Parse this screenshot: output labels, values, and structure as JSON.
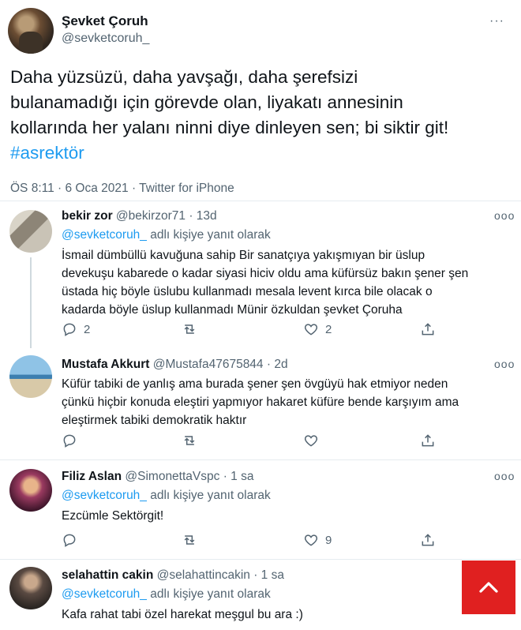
{
  "main_tweet": {
    "name": "Şevket Çoruh",
    "handle": "@sevketcoruh_",
    "more_icon": "···",
    "text_lines": [
      "Daha yüzsüzü, daha yavşağı,  daha şerefsizi",
      "bulanamadığı için görevde olan, liyakatı annesinin",
      "kollarında her yalanı ninni diye dinleyen sen; bi siktir git!"
    ],
    "hashtag": "#asrektör",
    "meta": "ÖS 8:11 · 6 Oca 2021 · Twitter for iPhone"
  },
  "replies": [
    {
      "name": "bekir zor",
      "handle": "@bekirzor71",
      "time": "· 13d",
      "replying_link": "@sevketcoruh_",
      "replying_suffix": " adlı kişiye yanıt olarak",
      "text_lines": [
        "İsmail dümbüllü kavuğuna sahip Bir sanatçıya yakışmıyan bir üslup",
        "devekuşu kabarede o kadar siyasi hiciv oldu ama küfürsüz bakın şener şen",
        "üstada hiç böyle üslubu kullanmadı mesala levent kırca bile olacak o",
        "kadarda böyle üslup kullanmadı Münir özkuldan şevket Çoruha"
      ],
      "reply_count": "2",
      "retweet_count": "",
      "like_count": "2"
    },
    {
      "name": "Mustafa Akkurt",
      "handle": "@Mustafa47675844",
      "time": "· 2d",
      "text_lines": [
        "Küfür tabiki de yanlış ama burada şener şen övgüyü hak etmiyor neden",
        "çünkü hiçbir konuda eleştiri yapmıyor hakaret küfüre bende karşıyım ama",
        "eleştirmek tabiki demokratik haktır"
      ],
      "reply_count": "",
      "retweet_count": "",
      "like_count": ""
    },
    {
      "name": "Filiz Aslan",
      "handle": "@SimonettaVspc",
      "time": "· 1 sa",
      "replying_link": "@sevketcoruh_",
      "replying_suffix": " adlı kişiye yanıt olarak",
      "text_lines": [
        "Ezcümle Sektörgit!"
      ],
      "reply_count": "",
      "retweet_count": "",
      "like_count": "9"
    },
    {
      "name": "selahattin cakin",
      "handle": "@selahattincakin",
      "time": "· 1 sa",
      "replying_link": "@sevketcoruh_",
      "replying_suffix": " adlı kişiye yanıt olarak",
      "text_lines": [
        "Kafa rahat tabi özel harekat meşgul bu ara :)"
      ]
    }
  ],
  "more_icon": "ooo",
  "icons": {
    "reply": "reply-icon",
    "retweet": "retweet-icon",
    "like": "heart-icon",
    "share": "share-icon",
    "scroll_top": "chevron-up-icon"
  },
  "colors": {
    "link": "#1d9bf0",
    "muted": "#536471",
    "scroll_button": "#e02020"
  }
}
